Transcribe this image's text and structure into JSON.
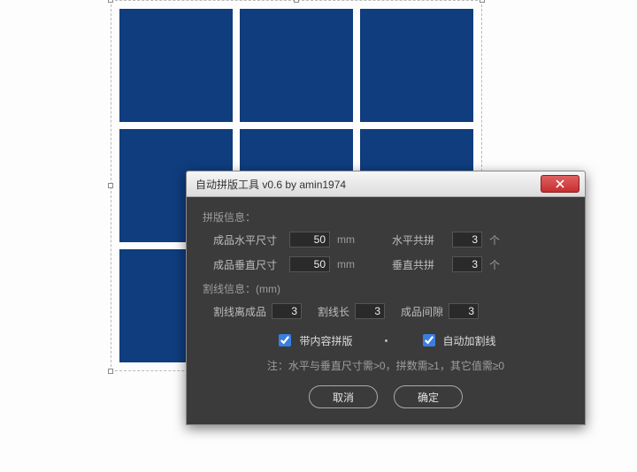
{
  "window": {
    "title": "自动拼版工具 v0.6   by amin1974"
  },
  "layout": {
    "section_label": "拼版信息：",
    "h_size_label": "成品水平尺寸",
    "h_size_value": "50",
    "h_size_unit": "mm",
    "h_count_label": "水平共拼",
    "h_count_value": "3",
    "h_count_unit": "个",
    "v_size_label": "成品垂直尺寸",
    "v_size_value": "50",
    "v_size_unit": "mm",
    "v_count_label": "垂直共拼",
    "v_count_value": "3",
    "v_count_unit": "个"
  },
  "cut": {
    "section_label": "割线信息：(mm)",
    "offset_label": "割线离成品",
    "offset_value": "3",
    "length_label": "割线长",
    "length_value": "3",
    "gap_label": "成品间隙",
    "gap_value": "3"
  },
  "options": {
    "with_content_label": "带内容拼版",
    "with_content_checked": true,
    "auto_cut_label": "自动加割线",
    "auto_cut_checked": true
  },
  "note": "注：水平与垂直尺寸需>0，拼数需≥1，其它值需≥0",
  "buttons": {
    "cancel": "取消",
    "ok": "确定"
  },
  "colors": {
    "cell": "#0f3d7e",
    "dialog_bg": "#3b3b3b"
  }
}
